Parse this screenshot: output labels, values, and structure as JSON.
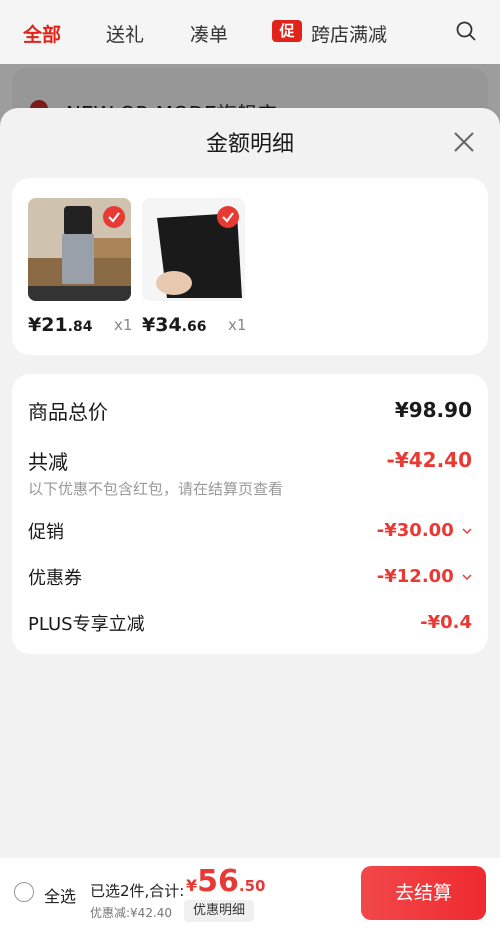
{
  "top_tabs": [
    "全部",
    "送礼",
    "凑单",
    "跨店满减"
  ],
  "promo_badge": "促",
  "background_store": "NEW OR MODE旗舰店",
  "sheet": {
    "title": "金额明细",
    "products": [
      {
        "price_int": "¥21",
        "price_dec": ".84",
        "qty": "x1"
      },
      {
        "price_int": "¥34",
        "price_dec": ".66",
        "qty": "x1"
      }
    ],
    "summary": {
      "total_label": "商品总价",
      "total_value": "¥98.90",
      "reduce_label": "共减",
      "reduce_value": "-¥42.40",
      "reduce_note": "以下优惠不包含红包，请在结算页查看",
      "promo_label": "促销",
      "promo_value": "-¥30.00",
      "coupon_label": "优惠券",
      "coupon_value": "-¥12.00",
      "plus_label": "PLUS专享立减",
      "plus_value": "-¥0.4"
    }
  },
  "bottom": {
    "select_all": "全选",
    "selected_text": "已选2件,合计:",
    "total_yen": "¥",
    "total_int": "56",
    "total_dec": ".50",
    "discount_text": "优惠减:¥42.40",
    "detail_button": "优惠明细",
    "checkout_button": "去结算"
  },
  "colors": {
    "accent": "#e83a35",
    "brand_red": "#e2231a"
  }
}
